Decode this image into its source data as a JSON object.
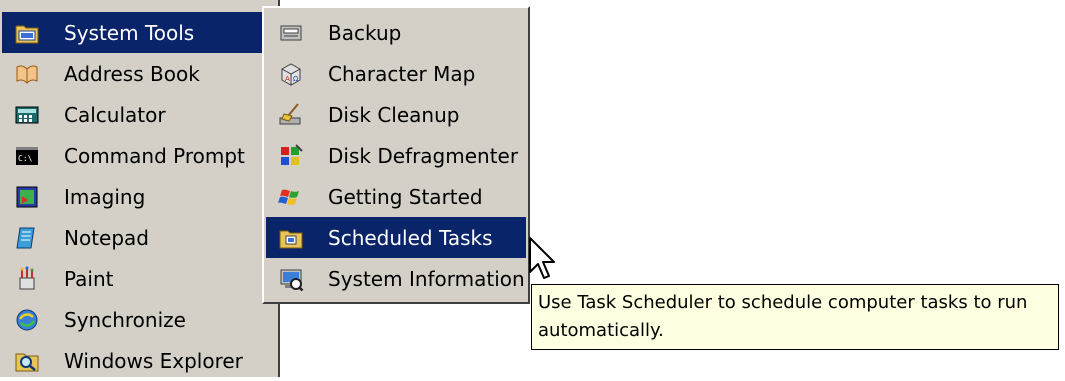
{
  "accessories_menu": {
    "items": [
      {
        "label": "System Tools",
        "icon": "system-tools-folder-icon",
        "selected": true,
        "has_submenu": true
      },
      {
        "label": "Address Book",
        "icon": "address-book-icon"
      },
      {
        "label": "Calculator",
        "icon": "calculator-icon"
      },
      {
        "label": "Command Prompt",
        "icon": "command-prompt-icon"
      },
      {
        "label": "Imaging",
        "icon": "imaging-icon"
      },
      {
        "label": "Notepad",
        "icon": "notepad-icon"
      },
      {
        "label": "Paint",
        "icon": "paint-icon"
      },
      {
        "label": "Synchronize",
        "icon": "synchronize-icon"
      },
      {
        "label": "Windows Explorer",
        "icon": "windows-explorer-icon"
      }
    ]
  },
  "system_tools_menu": {
    "items": [
      {
        "label": "Backup",
        "icon": "backup-icon"
      },
      {
        "label": "Character Map",
        "icon": "character-map-icon"
      },
      {
        "label": "Disk Cleanup",
        "icon": "disk-cleanup-icon"
      },
      {
        "label": "Disk Defragmenter",
        "icon": "disk-defragmenter-icon"
      },
      {
        "label": "Getting Started",
        "icon": "getting-started-icon"
      },
      {
        "label": "Scheduled Tasks",
        "icon": "scheduled-tasks-folder-icon",
        "selected": true
      },
      {
        "label": "System Information",
        "icon": "system-information-icon"
      }
    ]
  },
  "tooltip": {
    "line1": "Use Task Scheduler to schedule computer tasks to run",
    "line2": "automatically."
  },
  "colors": {
    "menu_bg": "#d4d0c8",
    "selection_bg": "#0a246a",
    "selection_text": "#ffffff",
    "tooltip_bg": "#ffffe1"
  }
}
